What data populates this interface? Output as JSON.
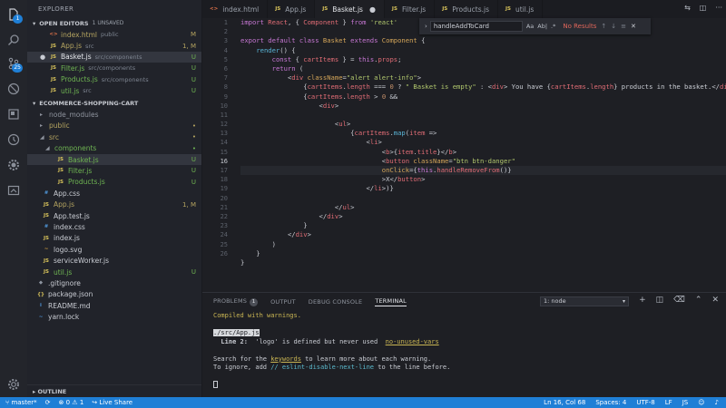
{
  "sidebar": {
    "title": "EXPLORER",
    "open_editors": {
      "header": "OPEN EDITORS",
      "badge": "1 UNSAVED",
      "items": [
        {
          "icon": "<>",
          "name": "index.html",
          "path": "public",
          "status": "M"
        },
        {
          "icon": "JS",
          "name": "App.js",
          "path": "src",
          "status": "1, M"
        },
        {
          "icon": "JS",
          "name": "Basket.js",
          "path": "src/components",
          "status": "U"
        },
        {
          "icon": "JS",
          "name": "Filter.js",
          "path": "src/components",
          "status": "U"
        },
        {
          "icon": "JS",
          "name": "Products.js",
          "path": "src/components",
          "status": "U"
        },
        {
          "icon": "JS",
          "name": "util.js",
          "path": "src",
          "status": "U"
        }
      ]
    },
    "project": {
      "header": "ECOMMERCE-SHOPPING-CART",
      "items": [
        {
          "name": "node_modules",
          "status": ""
        },
        {
          "name": "public",
          "status": "•"
        },
        {
          "name": "src",
          "status": "•"
        },
        {
          "name": "components",
          "status": "•"
        },
        {
          "icon": "JS",
          "name": "Basket.js",
          "status": "U"
        },
        {
          "icon": "JS",
          "name": "Filter.js",
          "status": "U"
        },
        {
          "icon": "JS",
          "name": "Products.js",
          "status": "U"
        },
        {
          "icon": "#",
          "name": "App.css",
          "status": ""
        },
        {
          "icon": "JS",
          "name": "App.js",
          "status": "1, M"
        },
        {
          "icon": "JS",
          "name": "App.test.js",
          "status": ""
        },
        {
          "icon": "#",
          "name": "index.css",
          "status": ""
        },
        {
          "icon": "JS",
          "name": "index.js",
          "status": ""
        },
        {
          "icon": "~",
          "name": "logo.svg",
          "status": ""
        },
        {
          "icon": "JS",
          "name": "serviceWorker.js",
          "status": ""
        },
        {
          "icon": "JS",
          "name": "util.js",
          "status": "U"
        },
        {
          "icon": "◆",
          "name": ".gitignore",
          "status": ""
        },
        {
          "icon": "{}",
          "name": "package.json",
          "status": ""
        },
        {
          "icon": "i",
          "name": "README.md",
          "status": ""
        },
        {
          "icon": "~",
          "name": "yarn.lock",
          "status": ""
        }
      ]
    },
    "outline": "OUTLINE"
  },
  "activity": {
    "explorer_badge": "1",
    "scm_badge": "25"
  },
  "tabs": [
    {
      "icon": "<>",
      "label": "index.html"
    },
    {
      "icon": "JS",
      "label": "App.js"
    },
    {
      "icon": "JS",
      "label": "Basket.js"
    },
    {
      "icon": "JS",
      "label": "Filter.js"
    },
    {
      "icon": "JS",
      "label": "Products.js"
    },
    {
      "icon": "JS",
      "label": "util.js"
    }
  ],
  "find": {
    "value": "handleAddToCard",
    "opt_case": "Aa",
    "opt_word": "Ab|",
    "opt_regex": ".*",
    "result": "No Results"
  },
  "editor": {
    "line_numbers": [
      "1",
      "2",
      "3",
      "4",
      "5",
      "6",
      "7",
      "8",
      "9",
      "10",
      "11",
      "12",
      "13",
      "14",
      "15",
      "16",
      "17",
      "18",
      "19",
      "20",
      "21",
      "22",
      "23",
      "24",
      "25",
      "26"
    ],
    "current_line": 16
  },
  "panel": {
    "tabs": {
      "problems": "PROBLEMS",
      "problems_count": "1",
      "output": "OUTPUT",
      "debug": "DEBUG CONSOLE",
      "terminal": "TERMINAL"
    },
    "terminal_select": "1: node",
    "lines": {
      "l1": "Compiled with warnings.",
      "l2": "./src/App.js",
      "l3a": "  Line 2:  ",
      "l3b": "'logo' is defined but never used  ",
      "l3c": "no-unused-vars",
      "l4a": "Search for the ",
      "l4b": "keywords",
      "l4c": " to learn more about each warning.",
      "l5a": "To ignore, add ",
      "l5b": "// eslint-disable-next-line",
      "l5c": " to the line before."
    }
  },
  "status": {
    "branch": "master*",
    "errors": "0",
    "warnings": "1",
    "live_share": "Live Share",
    "position": "Ln 16, Col 68",
    "spaces": "Spaces: 4",
    "encoding": "UTF-8",
    "eol": "LF",
    "language": "JS"
  },
  "colors": {
    "accent": "#1f7fd6",
    "editor_bg": "#1e1f24",
    "sidebar_bg": "#21232a"
  }
}
